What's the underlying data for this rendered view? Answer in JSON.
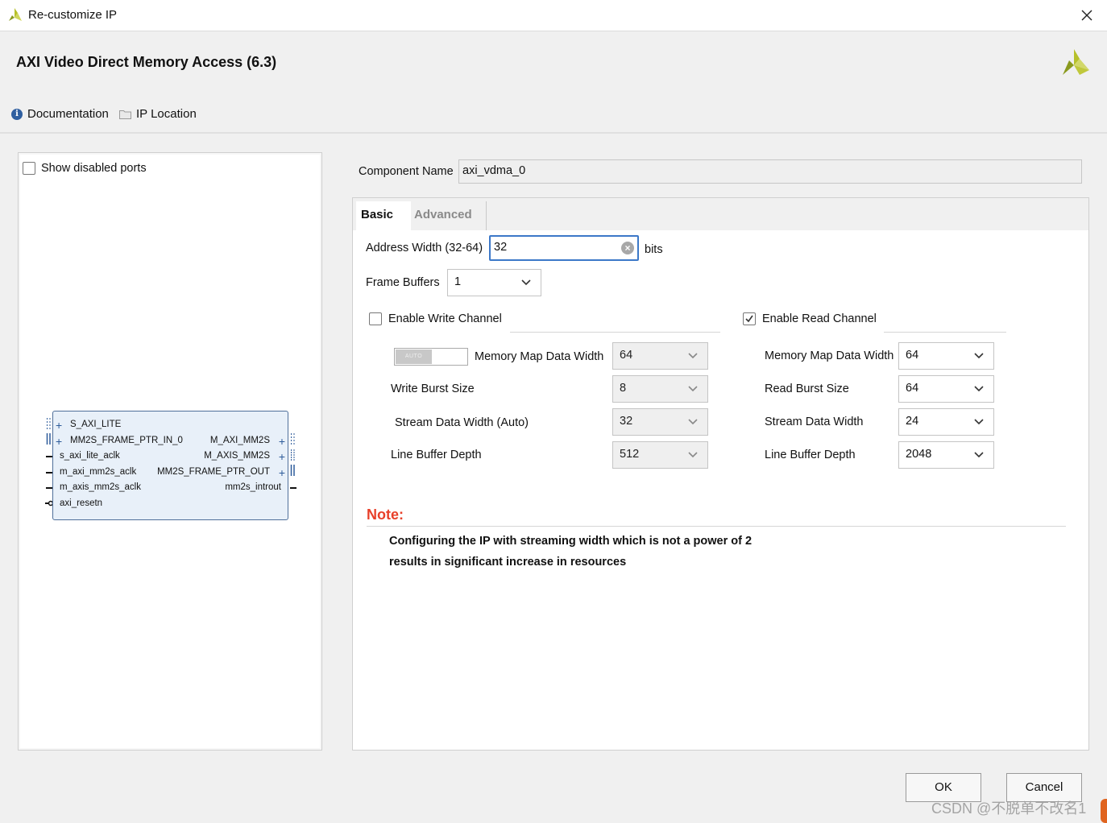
{
  "window": {
    "title": "Re-customize IP",
    "icon": "xilinx-logo-icon"
  },
  "header": {
    "ip_title": "AXI Video Direct Memory Access (6.3)",
    "documentation_label": "Documentation",
    "ip_location_label": "IP Location"
  },
  "left_panel": {
    "show_disabled_ports_label": "Show disabled ports",
    "show_disabled_ports_checked": false,
    "block": {
      "left_ports": [
        "S_AXI_LITE",
        "MM2S_FRAME_PTR_IN_0",
        "s_axi_lite_aclk",
        "m_axi_mm2s_aclk",
        "m_axis_mm2s_aclk",
        "axi_resetn"
      ],
      "right_ports": [
        "M_AXI_MM2S",
        "M_AXIS_MM2S",
        "MM2S_FRAME_PTR_OUT",
        "mm2s_introut"
      ]
    }
  },
  "component": {
    "label": "Component Name",
    "value": "axi_vdma_0"
  },
  "tabs": {
    "basic": "Basic",
    "advanced": "Advanced",
    "active": "Basic"
  },
  "basic": {
    "address_width_label": "Address Width (32-64)",
    "address_width_value": "32",
    "address_width_unit": "bits",
    "frame_buffers_label": "Frame Buffers",
    "frame_buffers_value": "1",
    "write_channel": {
      "label": "Enable Write Channel",
      "checked": false,
      "auto_toggle_label": "AUTO",
      "memory_map_data_width_label": "Memory Map Data Width",
      "memory_map_data_width_value": "64",
      "burst_size_label": "Write Burst Size",
      "burst_size_value": "8",
      "stream_data_width_label": "Stream Data Width (Auto)",
      "stream_data_width_value": "32",
      "line_buffer_depth_label": "Line Buffer Depth",
      "line_buffer_depth_value": "512"
    },
    "read_channel": {
      "label": "Enable Read Channel",
      "checked": true,
      "memory_map_data_width_label": "Memory Map Data Width",
      "memory_map_data_width_value": "64",
      "burst_size_label": "Read Burst Size",
      "burst_size_value": "64",
      "stream_data_width_label": "Stream Data Width",
      "stream_data_width_value": "24",
      "line_buffer_depth_label": "Line Buffer Depth",
      "line_buffer_depth_value": "2048"
    },
    "note": {
      "title": "Note:",
      "line1": "Configuring the IP with streaming width which is not a power of 2",
      "line2": "results in significant increase in resources"
    }
  },
  "buttons": {
    "ok": "OK",
    "cancel": "Cancel"
  },
  "watermark": "CSDN @不脱单不改名1",
  "colors": {
    "accent": "#3c78c8",
    "note": "#e8402a",
    "block_fill": "#e8f0f9",
    "block_border": "#4f6f9a"
  }
}
